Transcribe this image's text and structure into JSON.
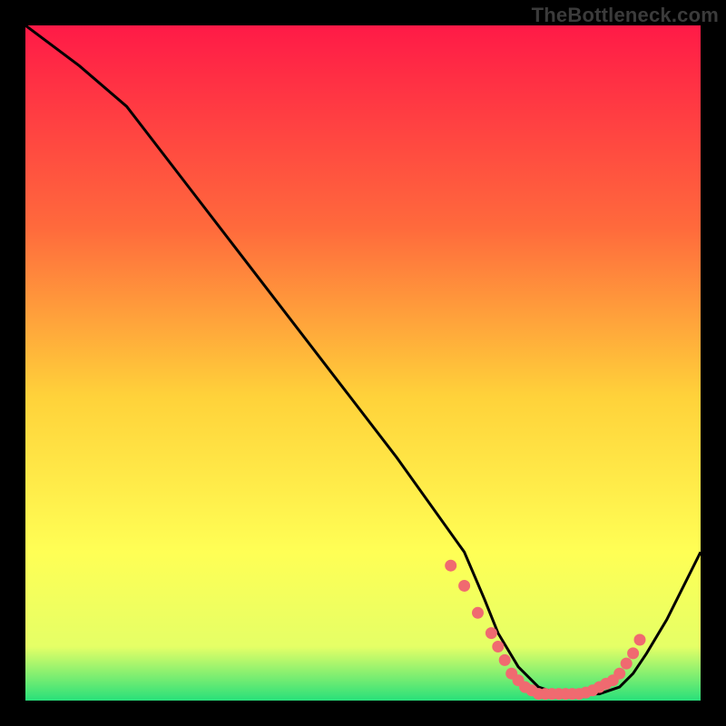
{
  "watermark": "TheBottleneck.com",
  "colors": {
    "bg": "#000000",
    "watermark": "#3b3b3b",
    "curve": "#000000",
    "dot_fill": "#f06a70",
    "dot_stroke": "#f06a70",
    "grad_top": "#ff1a47",
    "grad_mid1": "#ff6a3c",
    "grad_mid2": "#ffd23a",
    "grad_mid3": "#ffff55",
    "grad_mid4": "#e5ff66",
    "grad_bottom": "#28e07a"
  },
  "chart_data": {
    "type": "line",
    "title": "",
    "xlabel": "",
    "ylabel": "",
    "xlim": [
      0,
      100
    ],
    "ylim": [
      0,
      100
    ],
    "series": [
      {
        "name": "bottleneck-curve",
        "x": [
          0,
          8,
          15,
          25,
          35,
          45,
          55,
          60,
          65,
          68,
          70,
          73,
          76,
          79,
          82,
          85,
          88,
          90,
          92,
          95,
          100
        ],
        "y": [
          100,
          94,
          88,
          75,
          62,
          49,
          36,
          29,
          22,
          15,
          10,
          5,
          2,
          1,
          1,
          1,
          2,
          4,
          7,
          12,
          22
        ]
      }
    ],
    "highlight_points": {
      "name": "optimal-band-dots",
      "x": [
        63,
        65,
        67,
        69,
        70,
        71,
        72,
        73,
        74,
        75,
        76,
        77,
        78,
        79,
        80,
        81,
        82,
        83,
        84,
        85,
        86,
        87,
        88,
        89,
        90,
        91
      ],
      "y": [
        20,
        17,
        13,
        10,
        8,
        6,
        4,
        3,
        2,
        1.5,
        1,
        1,
        1,
        1,
        1,
        1,
        1,
        1.2,
        1.5,
        2,
        2.5,
        3,
        4,
        5.5,
        7,
        9
      ]
    }
  }
}
